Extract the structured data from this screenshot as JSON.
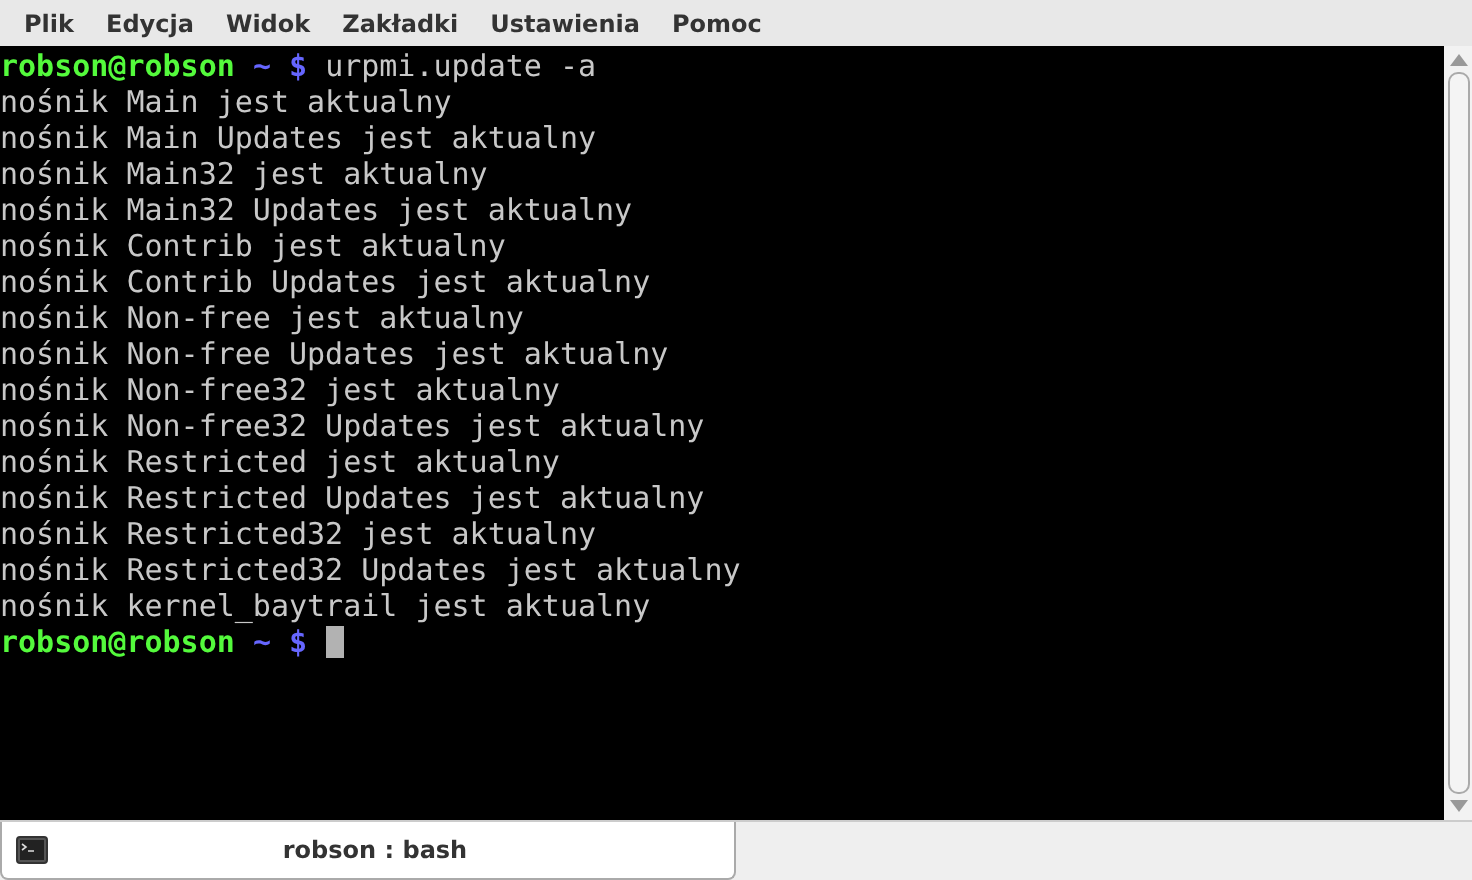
{
  "menu_bar": [
    "Plik",
    "Edycja",
    "Widok",
    "Zakładki",
    "Ustawienia",
    "Pomoc"
  ],
  "terminal": {
    "lines": [
      {
        "kind": "prompt",
        "user_host": "robson@robson",
        "path": "~",
        "symbol": "$",
        "command": "urpmi.update -a"
      },
      {
        "kind": "output",
        "text": "nośnik Main jest aktualny"
      },
      {
        "kind": "output",
        "text": "nośnik Main Updates jest aktualny"
      },
      {
        "kind": "output",
        "text": "nośnik Main32 jest aktualny"
      },
      {
        "kind": "output",
        "text": "nośnik Main32 Updates jest aktualny"
      },
      {
        "kind": "output",
        "text": "nośnik Contrib jest aktualny"
      },
      {
        "kind": "output",
        "text": "nośnik Contrib Updates jest aktualny"
      },
      {
        "kind": "output",
        "text": "nośnik Non-free jest aktualny"
      },
      {
        "kind": "output",
        "text": "nośnik Non-free Updates jest aktualny"
      },
      {
        "kind": "output",
        "text": "nośnik Non-free32 jest aktualny"
      },
      {
        "kind": "output",
        "text": "nośnik Non-free32 Updates jest aktualny"
      },
      {
        "kind": "output",
        "text": "nośnik Restricted jest aktualny"
      },
      {
        "kind": "output",
        "text": "nośnik Restricted Updates jest aktualny"
      },
      {
        "kind": "output",
        "text": "nośnik Restricted32 jest aktualny"
      },
      {
        "kind": "output",
        "text": "nośnik Restricted32 Updates jest aktualny"
      },
      {
        "kind": "output",
        "text": "nośnik kernel_baytrail jest aktualny"
      },
      {
        "kind": "prompt",
        "user_host": "robson@robson",
        "path": "~",
        "symbol": "$",
        "cursor": true
      }
    ]
  },
  "tabs": [
    {
      "label": "robson : bash",
      "selected": true
    }
  ]
}
